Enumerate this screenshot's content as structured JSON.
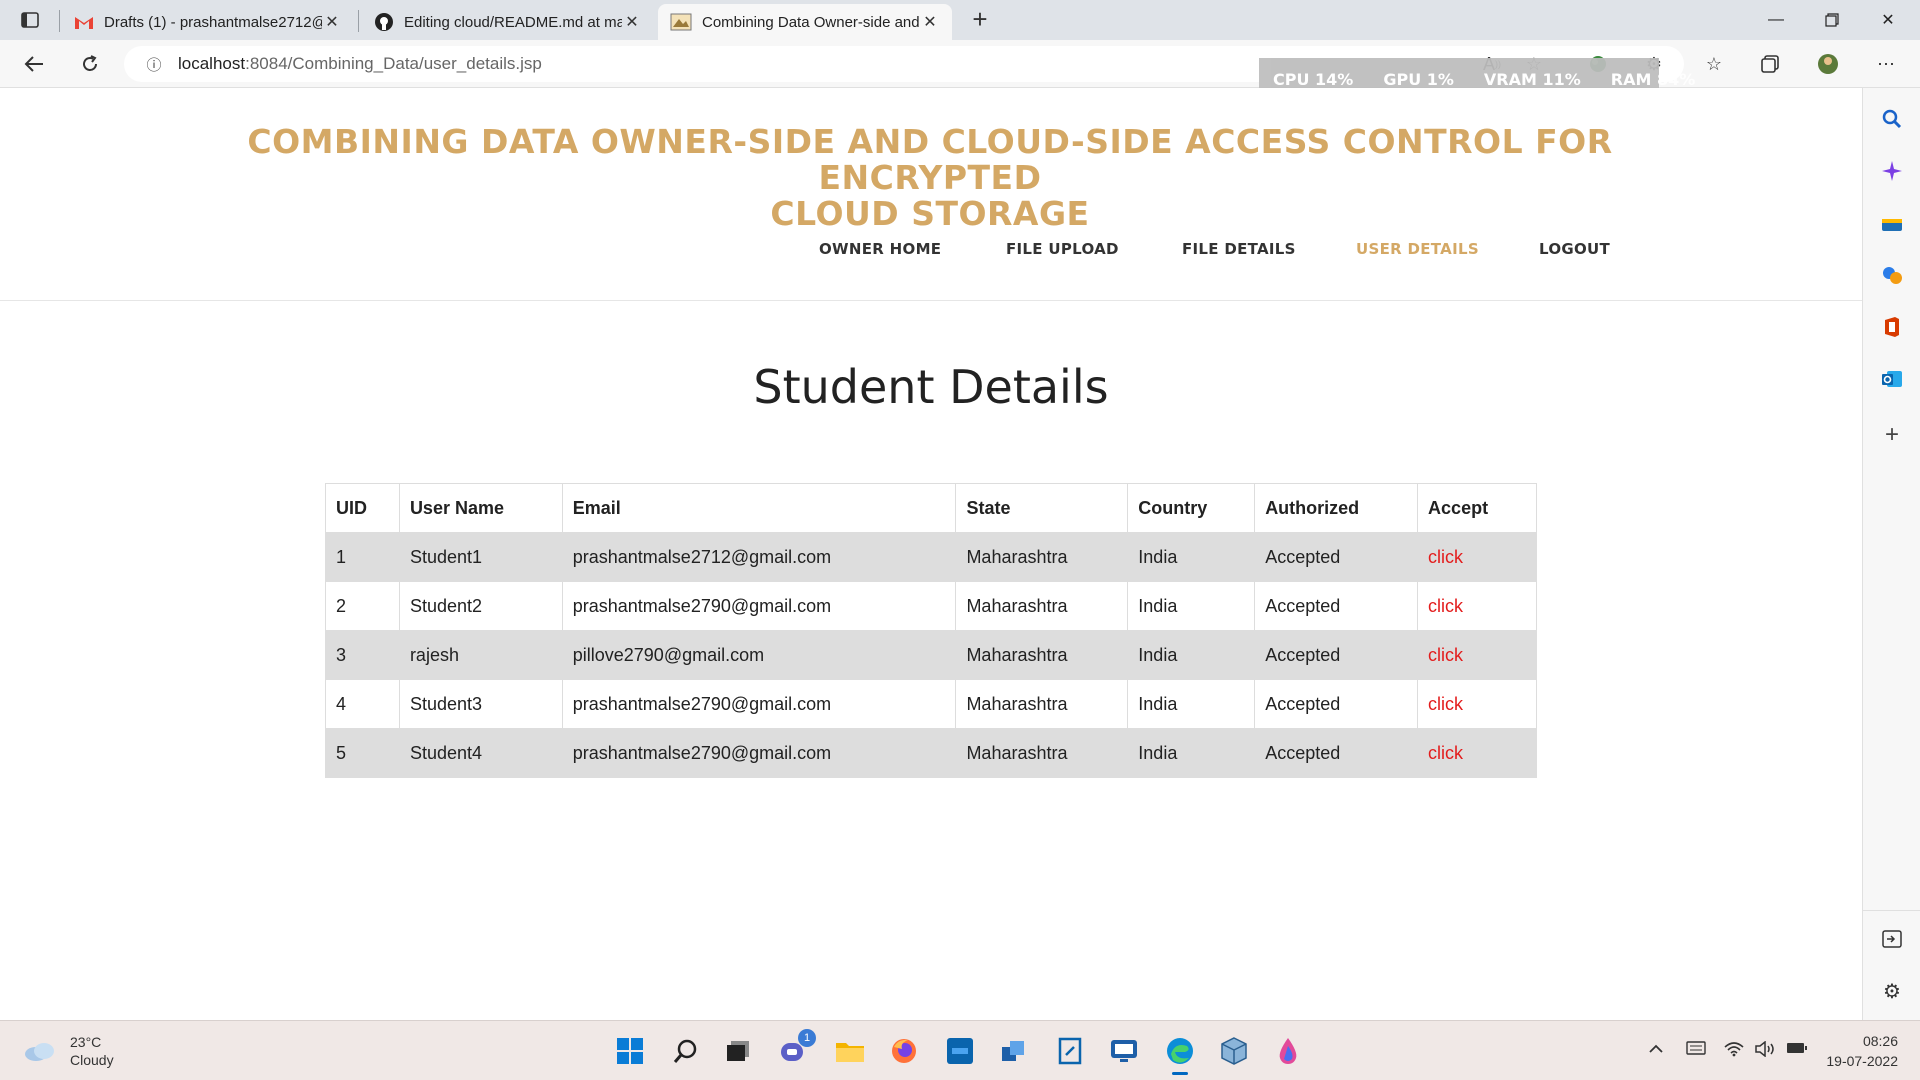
{
  "browser": {
    "tabs": [
      {
        "title": "Drafts (1) - prashantmalse2712@",
        "icon": "gmail-icon"
      },
      {
        "title": "Editing cloud/README.md at ma",
        "icon": "github-icon"
      },
      {
        "title": "Combining Data Owner-side and",
        "icon": "site-icon"
      }
    ],
    "url_host": "localhost",
    "url_rest": ":8084/Combining_Data/user_details.jsp",
    "perf_overlay": {
      "cpu": "CPU  14%",
      "gpu": "GPU   1%",
      "vram": "VRAM  11%",
      "ram": "RAM  84%"
    }
  },
  "site": {
    "title_line1": "COMBINING DATA OWNER-SIDE AND CLOUD-SIDE ACCESS CONTROL FOR ENCRYPTED",
    "title_line2": "CLOUD STORAGE",
    "nav": [
      {
        "label": "OWNER HOME"
      },
      {
        "label": "FILE UPLOAD"
      },
      {
        "label": "FILE DETAILS"
      },
      {
        "label": "USER DETAILS",
        "active": true
      },
      {
        "label": "LOGOUT"
      }
    ],
    "heading": "Student Details"
  },
  "table": {
    "headers": [
      "UID",
      "User Name",
      "Email",
      "State",
      "Country",
      "Authorized",
      "Accept"
    ],
    "rows": [
      {
        "uid": "1",
        "name": "Student1",
        "email": "prashantmalse2712@gmail.com",
        "state": "Maharashtra",
        "country": "India",
        "authorized": "Accepted",
        "accept": "click"
      },
      {
        "uid": "2",
        "name": "Student2",
        "email": "prashantmalse2790@gmail.com",
        "state": "Maharashtra",
        "country": "India",
        "authorized": "Accepted",
        "accept": "click"
      },
      {
        "uid": "3",
        "name": "rajesh",
        "email": "pillove2790@gmail.com",
        "state": "Maharashtra",
        "country": "India",
        "authorized": "Accepted",
        "accept": "click"
      },
      {
        "uid": "4",
        "name": "Student3",
        "email": "prashantmalse2790@gmail.com",
        "state": "Maharashtra",
        "country": "India",
        "authorized": "Accepted",
        "accept": "click"
      },
      {
        "uid": "5",
        "name": "Student4",
        "email": "prashantmalse2790@gmail.com",
        "state": "Maharashtra",
        "country": "India",
        "authorized": "Accepted",
        "accept": "click"
      }
    ]
  },
  "taskbar": {
    "weather_temp": "23°C",
    "weather_desc": "Cloudy",
    "chat_badge": "1",
    "time": "08:26",
    "date": "19-07-2022"
  },
  "colors": {
    "accent": "#d4a865",
    "link": "#e31c1c",
    "row_stripe": "#dddddd"
  }
}
